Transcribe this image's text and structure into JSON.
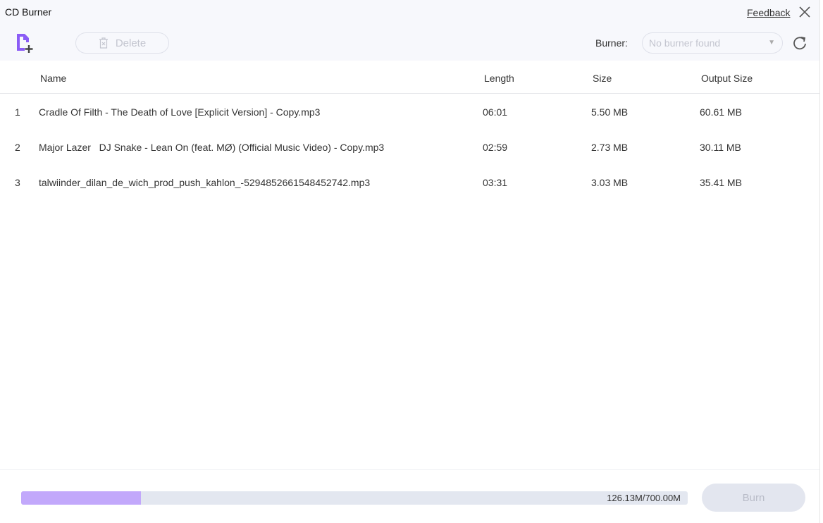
{
  "window": {
    "title": "CD Burner",
    "feedback": "Feedback"
  },
  "toolbar": {
    "delete_label": "Delete",
    "burner_label": "Burner:",
    "burner_value": "No burner found"
  },
  "table": {
    "columns": [
      "Name",
      "Length",
      "Size",
      "Output Size"
    ],
    "rows": [
      {
        "index": "1",
        "name": "Cradle Of Filth - The Death of Love [Explicit Version] - Copy.mp3",
        "length": "06:01",
        "size": "5.50 MB",
        "output": "60.61 MB"
      },
      {
        "index": "2",
        "name": "Major Lazer   DJ Snake - Lean On (feat. MØ) (Official Music Video) - Copy.mp3",
        "length": "02:59",
        "size": "2.73 MB",
        "output": "30.11 MB"
      },
      {
        "index": "3",
        "name": "talwiinder_dilan_de_wich_prod_push_kahlon_-5294852661548452742.mp3",
        "length": "03:31",
        "size": "3.03 MB",
        "output": "35.41 MB"
      }
    ]
  },
  "footer": {
    "capacity_text": "126.13M/700.00M",
    "progress_percent": 18.02,
    "burn_label": "Burn"
  },
  "colors": {
    "accent": "#8b5cf6",
    "progress_fill": "#c2a8fb",
    "progress_track": "#e3e7f0"
  }
}
